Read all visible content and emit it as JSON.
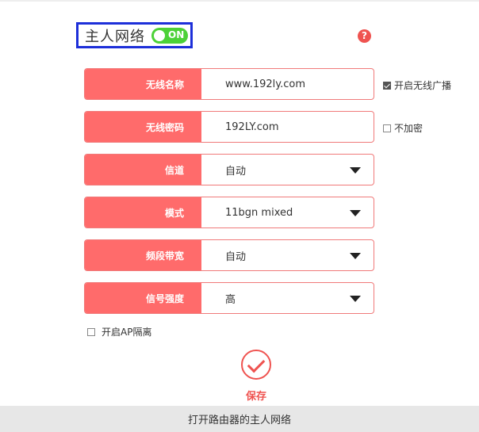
{
  "header": {
    "title": "主人网络",
    "toggle_label": "ON",
    "help_icon_text": "?"
  },
  "fields": [
    {
      "label": "无线名称",
      "value": "www.192ly.com",
      "type": "text"
    },
    {
      "label": "无线密码",
      "value": "192LY.com",
      "type": "text"
    },
    {
      "label": "信道",
      "value": "自动",
      "type": "select"
    },
    {
      "label": "模式",
      "value": "11bgn mixed",
      "type": "select"
    },
    {
      "label": "频段带宽",
      "value": "自动",
      "type": "select"
    },
    {
      "label": "信号强度",
      "value": "高",
      "type": "select"
    }
  ],
  "options": {
    "broadcast_label": "开启无线广播",
    "broadcast_checked": true,
    "no_encrypt_label": "不加密",
    "no_encrypt_checked": false,
    "ap_isolation_label": "开启AP隔离",
    "ap_isolation_checked": false
  },
  "save": {
    "label": "保存"
  },
  "caption": "打开路由器的主人网络",
  "colors": {
    "accent": "#ff6b6b",
    "toggle_on": "#4cd137",
    "highlight_box": "#1d2fd9"
  }
}
